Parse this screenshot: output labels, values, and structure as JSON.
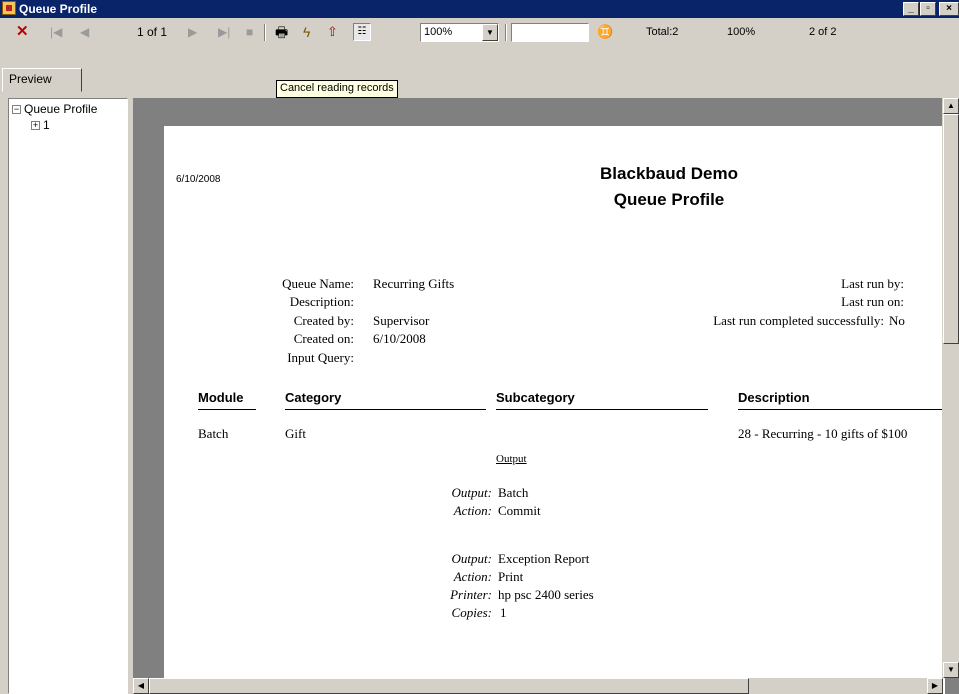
{
  "window": {
    "title": "Queue Profile"
  },
  "toolbar": {
    "page_of": "1 of 1",
    "zoom": "100%",
    "search_value": "",
    "total": "Total:2",
    "percent": "100%",
    "records": "2 of 2"
  },
  "tabs": {
    "preview": "Preview"
  },
  "tooltip": "Cancel reading records",
  "tree": {
    "root": "Queue Profile",
    "child": "1"
  },
  "report": {
    "date": "6/10/2008",
    "org": "Blackbaud Demo",
    "title": "Queue Profile",
    "labels": {
      "queue_name": "Queue Name:",
      "description": "Description:",
      "created_by": "Created by:",
      "created_on": "Created on:",
      "input_query": "Input Query:",
      "last_run_by": "Last run by:",
      "last_run_on": "Last run on:",
      "last_run_success": "Last run completed successfully:"
    },
    "values": {
      "queue_name": "Recurring Gifts",
      "created_by": "Supervisor",
      "created_on": "6/10/2008",
      "last_run_success": "No"
    },
    "columns": [
      "Module",
      "Category",
      "Subcategory",
      "Description"
    ],
    "row": {
      "module": "Batch",
      "category": "Gift",
      "description": "28 - Recurring - 10 gifts of $100"
    },
    "output_heading": "Output",
    "output_labels": {
      "output": "Output:",
      "action": "Action:",
      "printer": "Printer:",
      "copies": "Copies:"
    },
    "output1": {
      "output": "Batch",
      "action": "Commit"
    },
    "output2": {
      "output": "Exception Report",
      "action": "Print",
      "printer": "hp psc 2400 series",
      "copies": "1"
    }
  }
}
